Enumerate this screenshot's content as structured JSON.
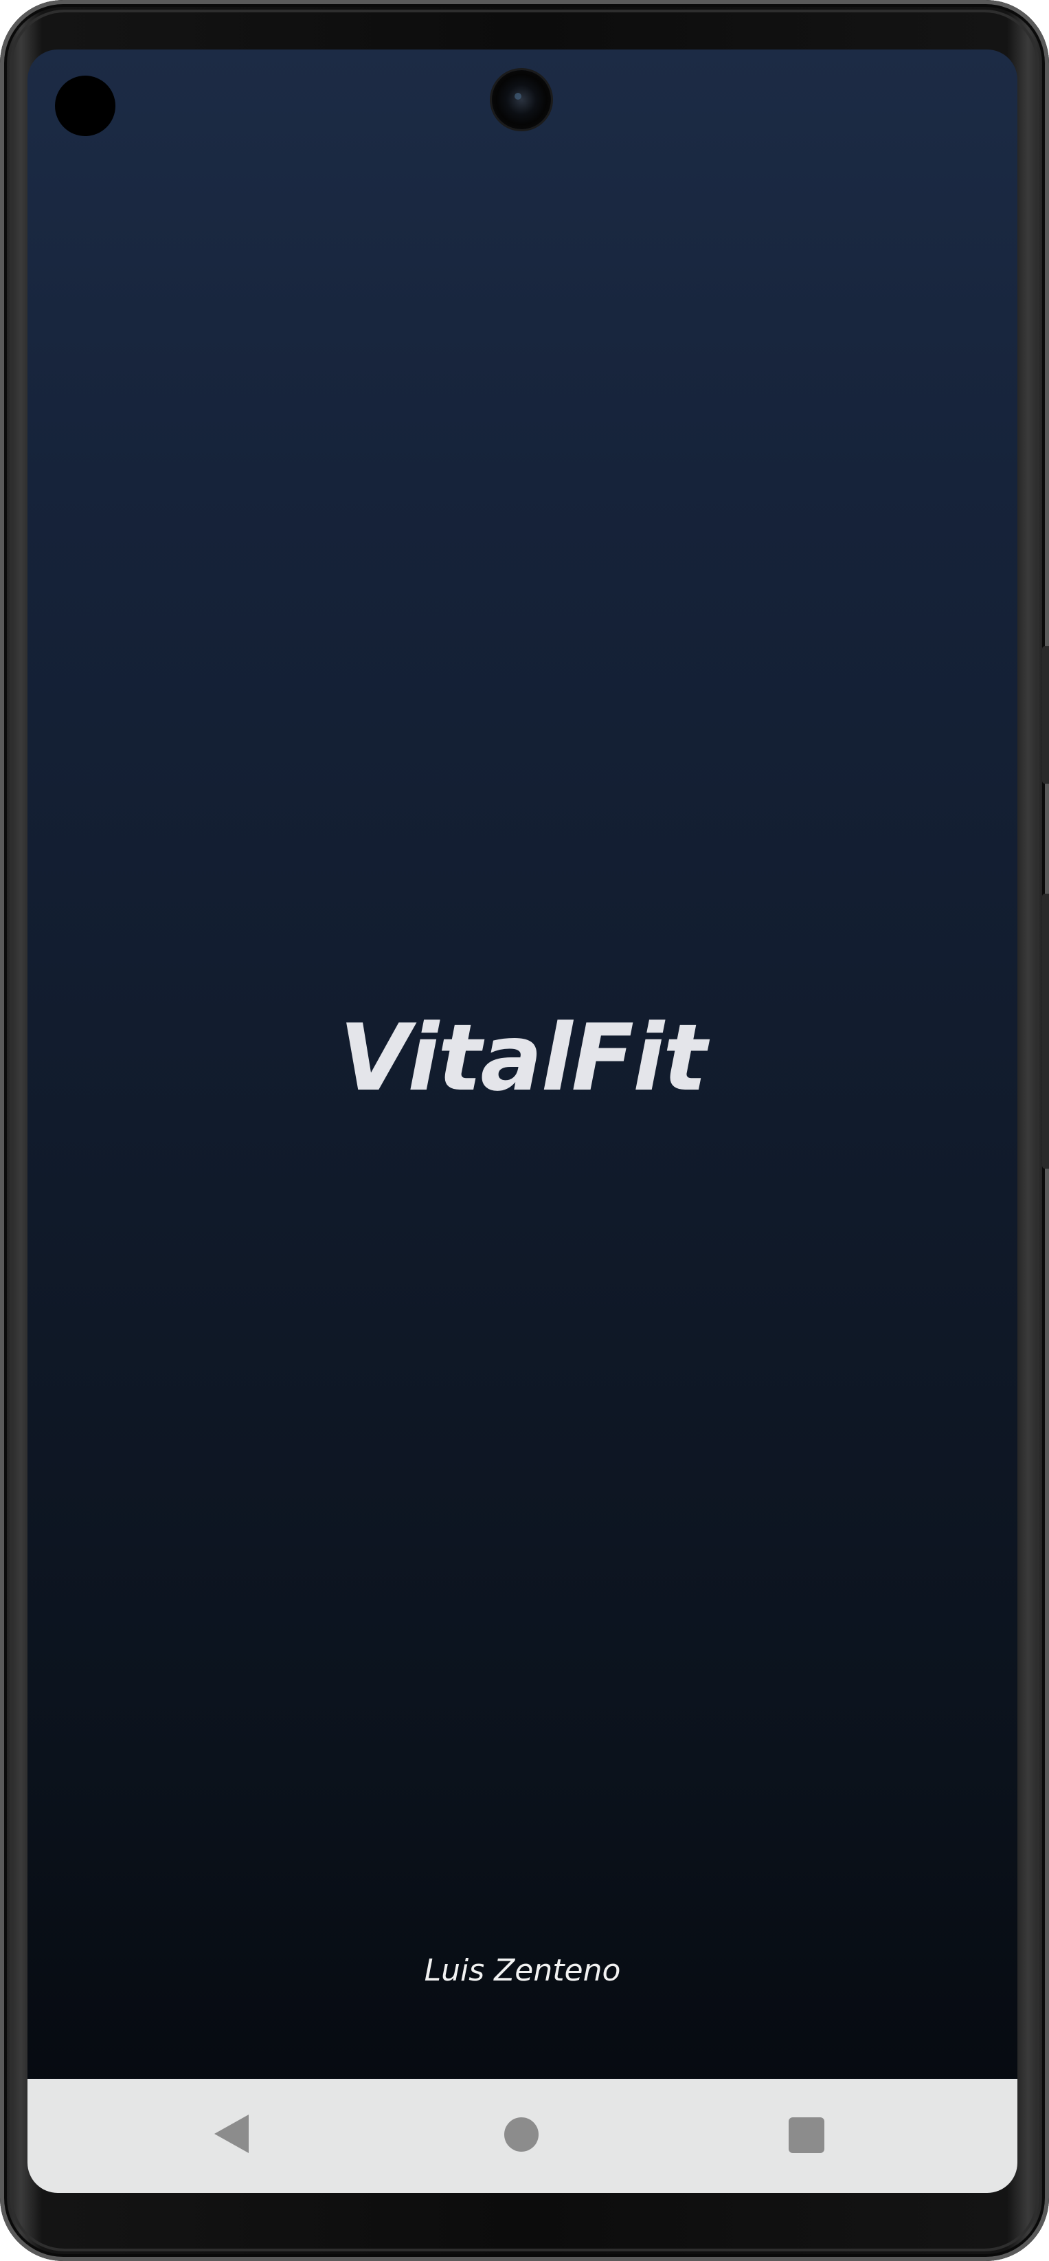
{
  "app": {
    "title": "VitalFit",
    "author": "Luis Zenteno"
  },
  "colors": {
    "background_top": "#1c2b45",
    "background_bottom": "#05080d",
    "title_text": "#e4e5ea",
    "nav_bar": "#e5e6e6",
    "nav_icons": "#8c8c8c"
  },
  "navigation": {
    "back_icon": "back-triangle-icon",
    "home_icon": "home-circle-icon",
    "recents_icon": "recents-square-icon"
  }
}
